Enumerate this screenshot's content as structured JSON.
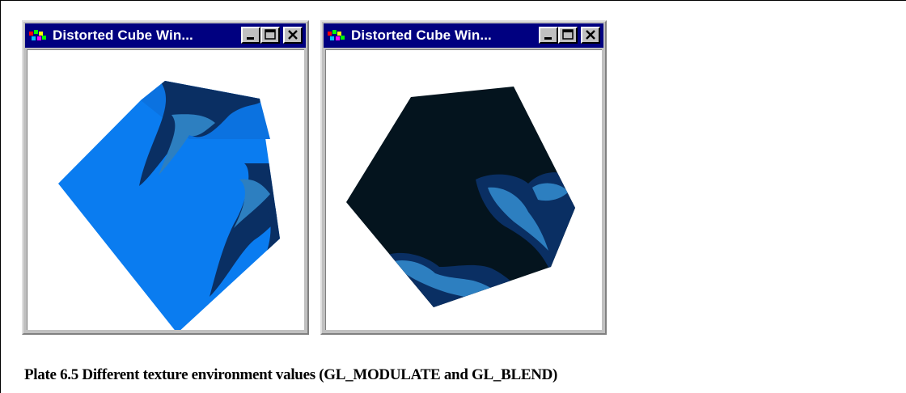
{
  "windows": [
    {
      "title": "Distorted Cube Win...",
      "icon": "opengl-app-icon",
      "mode": "GL_MODULATE"
    },
    {
      "title": "Distorted Cube Win...",
      "icon": "opengl-app-icon",
      "mode": "GL_BLEND"
    }
  ],
  "caption": "Plate 6.5 Different texture environment values (GL_MODULATE and GL_BLEND)",
  "colors": {
    "titlebar": "#000080",
    "window_face": "#c0c0c0",
    "modulate_face": "#0a7cf0",
    "blend_face": "#04141e",
    "texture_dark": "#0a2f63",
    "texture_light": "#2d7fc0"
  }
}
